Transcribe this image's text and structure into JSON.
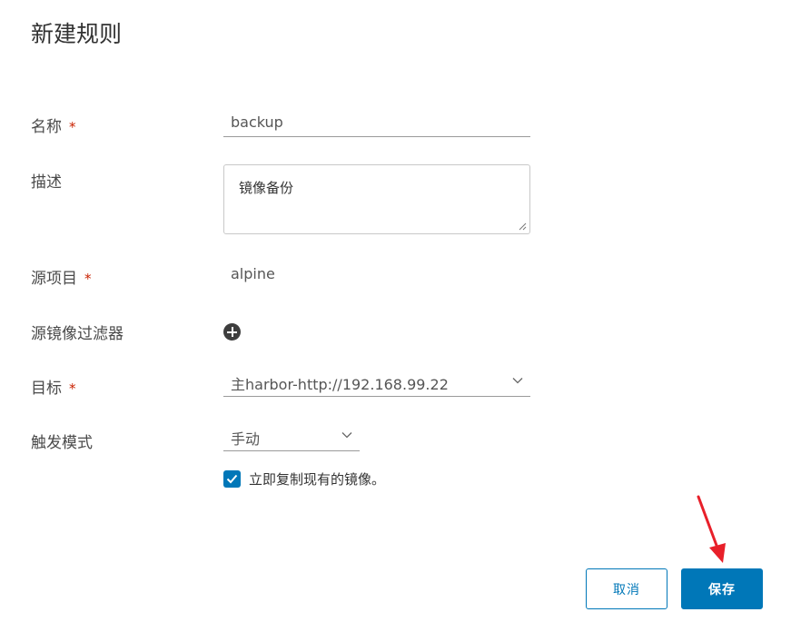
{
  "dialog": {
    "title": "新建规则"
  },
  "form": {
    "name": {
      "label": "名称",
      "required_mark": "*",
      "value": "backup"
    },
    "description": {
      "label": "描述",
      "value": "镜像备份"
    },
    "source_project": {
      "label": "源项目",
      "required_mark": "*",
      "value": "alpine"
    },
    "source_filter": {
      "label": "源镜像过滤器",
      "add_icon": "plus-circle-icon"
    },
    "target": {
      "label": "目标",
      "required_mark": "*",
      "selected": "主harbor-http://192.168.99.22"
    },
    "trigger": {
      "label": "触发模式",
      "selected": "手动"
    },
    "replicate_existing": {
      "checked": true,
      "label": "立即复制现有的镜像。"
    }
  },
  "buttons": {
    "cancel_label": "取消",
    "save_label": "保存"
  },
  "colors": {
    "primary": "#0077b8",
    "required": "#c92100",
    "annotation_arrow": "#e8202a"
  }
}
